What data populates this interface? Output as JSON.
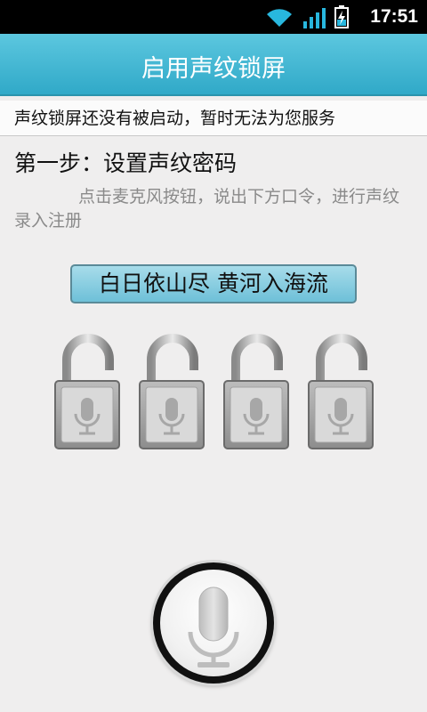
{
  "status_bar": {
    "time": "17:51",
    "icons": [
      "wifi-icon",
      "signal-icon",
      "battery-charging-icon"
    ]
  },
  "header": {
    "title": "启用声纹锁屏"
  },
  "notice": {
    "text": "声纹锁屏还没有被启动，暂时无法为您服务"
  },
  "step": {
    "title": "第一步：设置声纹密码",
    "instruction": "点击麦克风按钮，说出下方口令，进行声纹录入注册"
  },
  "passphrase": {
    "text": "白日依山尽 黄河入海流"
  },
  "locks": [
    {
      "icon": "unlocked-padlock-microphone-icon"
    },
    {
      "icon": "unlocked-padlock-microphone-icon"
    },
    {
      "icon": "unlocked-padlock-microphone-icon"
    },
    {
      "icon": "unlocked-padlock-microphone-icon"
    }
  ],
  "record": {
    "icon": "microphone-icon"
  },
  "colors": {
    "title_bar": "#3ab5d2",
    "phrase_bg": "#8fd0e3",
    "background": "#efeeee"
  }
}
